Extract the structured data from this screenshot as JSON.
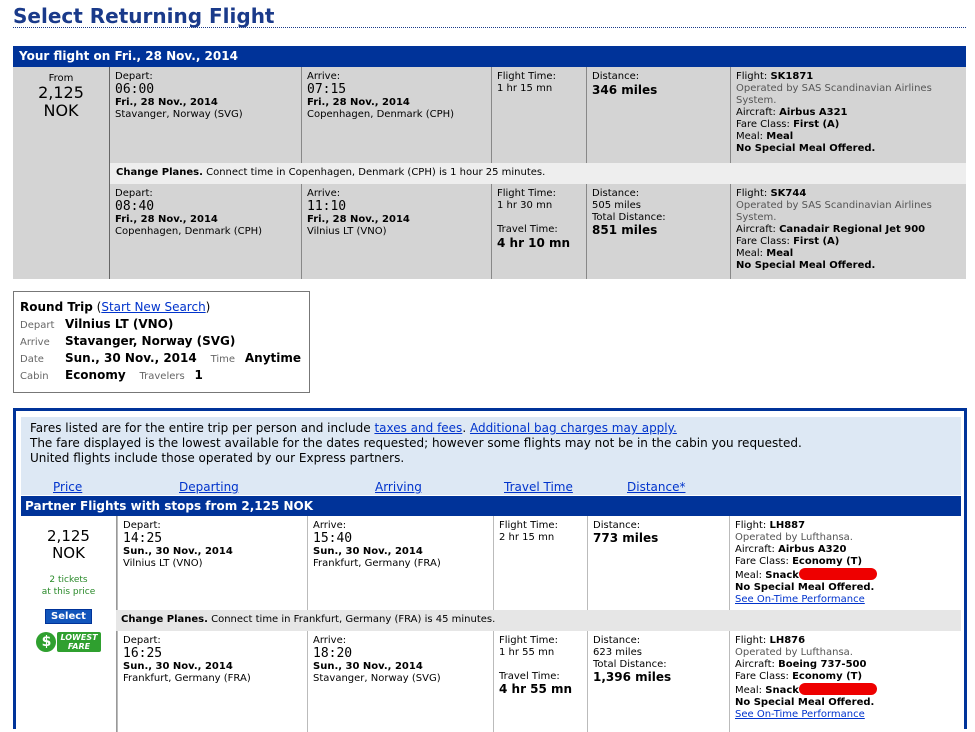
{
  "page_title": "Select Returning Flight",
  "selected": {
    "header": "Your flight on Fri., 28 Nov., 2014",
    "from_label": "From",
    "amount": "2,125",
    "currency": "NOK",
    "seg1": {
      "depart_label": "Depart:",
      "depart_time": "06:00",
      "depart_date": "Fri., 28 Nov., 2014",
      "depart_place": "Stavanger, Norway (SVG)",
      "arrive_label": "Arrive:",
      "arrive_time": "07:15",
      "arrive_date": "Fri., 28 Nov., 2014",
      "arrive_place": "Copenhagen, Denmark (CPH)",
      "ft_label": "Flight Time:",
      "ft": "1 hr 15 mn",
      "dist_label": "Distance:",
      "dist": "346 miles",
      "flight_label": "Flight:",
      "flight": "SK1871",
      "operated": "Operated by SAS Scandinavian Airlines System.",
      "aircraft_label": "Aircraft:",
      "aircraft": "Airbus A321",
      "fare_label": "Fare Class:",
      "fare": "First (A)",
      "meal_label": "Meal:",
      "meal": "Meal",
      "special": "No Special Meal Offered."
    },
    "change_bold": "Change Planes.",
    "change_text": "Connect time in Copenhagen, Denmark (CPH) is 1 hour 25 minutes.",
    "seg2": {
      "depart_label": "Depart:",
      "depart_time": "08:40",
      "depart_date": "Fri., 28 Nov., 2014",
      "depart_place": "Copenhagen, Denmark (CPH)",
      "arrive_label": "Arrive:",
      "arrive_time": "11:10",
      "arrive_date": "Fri., 28 Nov., 2014",
      "arrive_place": "Vilnius LT (VNO)",
      "ft_label": "Flight Time:",
      "ft": "1 hr 30 mn",
      "tt_label": "Travel Time:",
      "tt": "4 hr 10 mn",
      "dist_label": "Distance:",
      "dist": "505 miles",
      "tdist_label": "Total Distance:",
      "tdist": "851 miles",
      "flight_label": "Flight:",
      "flight": "SK744",
      "operated": "Operated by SAS Scandinavian Airlines System.",
      "aircraft_label": "Aircraft:",
      "aircraft": "Canadair Regional Jet 900",
      "fare_label": "Fare Class:",
      "fare": "First (A)",
      "meal_label": "Meal:",
      "meal": "Meal",
      "special": "No Special Meal Offered."
    }
  },
  "roundtrip": {
    "title": "Round Trip",
    "new_search": "Start New Search",
    "depart_k": "Depart",
    "depart_v": "Vilnius LT (VNO)",
    "arrive_k": "Arrive",
    "arrive_v": "Stavanger, Norway (SVG)",
    "date_k": "Date",
    "date_v": "Sun., 30 Nov., 2014",
    "time_k": "Time",
    "time_v": "Anytime",
    "cabin_k": "Cabin",
    "cabin_v": "Economy",
    "travelers_k": "Travelers",
    "travelers_v": "1"
  },
  "notice": {
    "line1_a": "Fares listed are for the entire trip per person and include ",
    "taxes_link": "taxes and fees",
    "bag_link": "Additional bag charges may apply.",
    "line2": "The fare displayed is the lowest available for the dates requested; however some flights may not be in the cabin you requested.",
    "line3": "United flights include those operated by our Express partners."
  },
  "sort": {
    "price": "Price",
    "departing": "Departing",
    "arriving": "Arriving",
    "travel_time": "Travel Time",
    "distance": "Distance*"
  },
  "partner_header": "Partner Flights with stops from 2,125 NOK",
  "result": {
    "amount": "2,125",
    "currency": "NOK",
    "tickets": "2 tickets",
    "at_price": "at this price",
    "select": "Select",
    "lowest_coin": "$",
    "lowest_1": "LOWEST",
    "lowest_2": "FARE",
    "seg1": {
      "depart_label": "Depart:",
      "depart_time": "14:25",
      "depart_date": "Sun., 30 Nov., 2014",
      "depart_place": "Vilnius LT (VNO)",
      "arrive_label": "Arrive:",
      "arrive_time": "15:40",
      "arrive_date": "Sun., 30 Nov., 2014",
      "arrive_place": "Frankfurt, Germany (FRA)",
      "ft_label": "Flight Time:",
      "ft": "2 hr 15 mn",
      "dist_label": "Distance:",
      "dist": "773 miles",
      "flight_label": "Flight:",
      "flight": "LH887",
      "operated": "Operated by Lufthansa.",
      "aircraft_label": "Aircraft:",
      "aircraft": "Airbus A320",
      "fare_label": "Fare Class:",
      "fare": "Economy (T)",
      "meal_label": "Meal:",
      "meal": "Snack",
      "special": "No Special Meal Offered.",
      "ontime": "See On-Time Performance"
    },
    "change_bold": "Change Planes.",
    "change_text": "Connect time in Frankfurt, Germany (FRA) is 45 minutes.",
    "seg2": {
      "depart_label": "Depart:",
      "depart_time": "16:25",
      "depart_date": "Sun., 30 Nov., 2014",
      "depart_place": "Frankfurt, Germany (FRA)",
      "arrive_label": "Arrive:",
      "arrive_time": "18:20",
      "arrive_date": "Sun., 30 Nov., 2014",
      "arrive_place": "Stavanger, Norway (SVG)",
      "ft_label": "Flight Time:",
      "ft": "1 hr 55 mn",
      "tt_label": "Travel Time:",
      "tt": "4 hr 55 mn",
      "dist_label": "Distance:",
      "dist": "623 miles",
      "tdist_label": "Total Distance:",
      "tdist": "1,396 miles",
      "flight_label": "Flight:",
      "flight": "LH876",
      "operated": "Operated by Lufthansa.",
      "aircraft_label": "Aircraft:",
      "aircraft": "Boeing 737-500",
      "fare_label": "Fare Class:",
      "fare": "Economy (T)",
      "meal_label": "Meal:",
      "meal": "Snack",
      "special": "No Special Meal Offered.",
      "ontime": "See On-Time Performance"
    }
  }
}
